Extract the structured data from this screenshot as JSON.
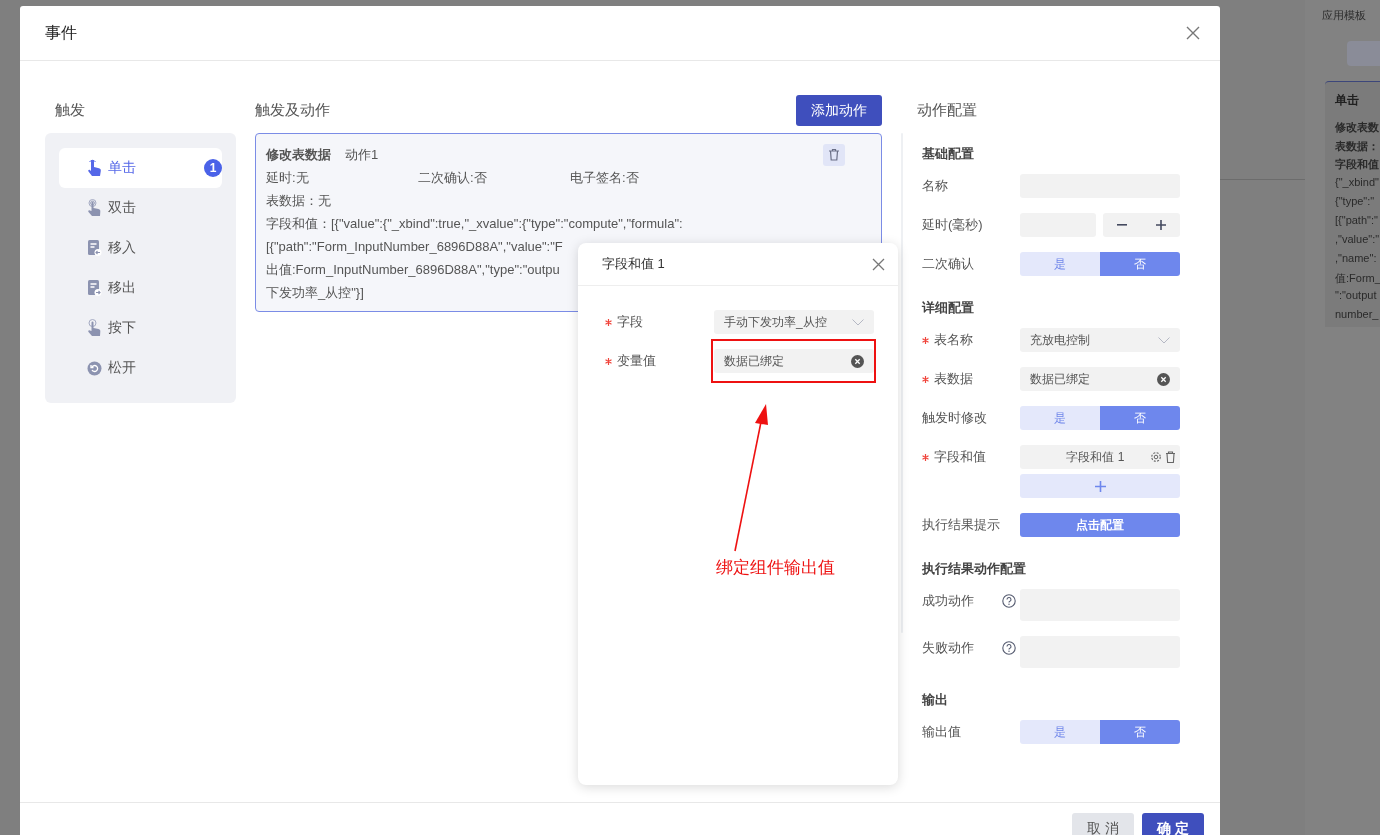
{
  "modal": {
    "title": "事件"
  },
  "trigger_panel": {
    "title": "触发",
    "items": [
      {
        "label": "单击",
        "kind": "tap",
        "selected": true,
        "badge": "1"
      },
      {
        "label": "双击",
        "kind": "double-tap",
        "selected": false
      },
      {
        "label": "移入",
        "kind": "enter",
        "selected": false
      },
      {
        "label": "移出",
        "kind": "leave",
        "selected": false
      },
      {
        "label": "按下",
        "kind": "press",
        "selected": false
      },
      {
        "label": "松开",
        "kind": "release",
        "selected": false
      }
    ]
  },
  "actions_panel": {
    "title": "触发及动作",
    "add_button": "添加动作",
    "actions": [
      {
        "name": "修改表数据",
        "label": "动作1",
        "selected": true,
        "details": [
          "延时:无",
          "二次确认:否",
          "电子签名:否"
        ],
        "table_data": "表数据：无",
        "field_lines": [
          "字段和值：[{\"value\":{\"_xbind\":true,\"_xvalue\":{\"type\":\"compute\",\"formula\":",
          "[{\"path\":\"Form_InputNumber_6896D88A\",\"value\":\"F",
          "出值:Form_InputNumber_6896D88A\",\"type\":\"outpu",
          "下发功率_从控\"}]"
        ]
      }
    ]
  },
  "config_panel": {
    "title": "动作配置",
    "rows": [
      {
        "kind": "section",
        "label": "基础配置"
      },
      {
        "kind": "input",
        "label": "名称",
        "required": false
      },
      {
        "kind": "stepper",
        "label": "延时(毫秒)",
        "required": false
      },
      {
        "kind": "toggle",
        "label": "二次确认",
        "required": false,
        "options": [
          {
            "label": "是",
            "selected": false
          },
          {
            "label": "否",
            "selected": true
          }
        ]
      },
      {
        "kind": "section",
        "label": "详细配置"
      },
      {
        "kind": "select",
        "label": "表名称",
        "required": true,
        "value": "充放电控制"
      },
      {
        "kind": "clearable",
        "label": "表数据",
        "required": true,
        "value": "数据已绑定"
      },
      {
        "kind": "toggle",
        "label": "触发时修改",
        "required": false,
        "options": [
          {
            "label": "是",
            "selected": false
          },
          {
            "label": "否",
            "selected": true
          }
        ]
      },
      {
        "kind": "list",
        "label": "字段和值",
        "required": true,
        "items": [
          "字段和值 1"
        ]
      },
      {
        "kind": "add"
      },
      {
        "kind": "button",
        "label": "执行结果提示",
        "required": false,
        "button": "点击配置"
      },
      {
        "kind": "section",
        "label": "执行结果动作配置"
      },
      {
        "kind": "textarea",
        "label": "成功动作",
        "required": false,
        "help": true
      },
      {
        "kind": "textarea",
        "label": "失败动作",
        "required": false,
        "help": true
      },
      {
        "kind": "section",
        "label": "输出"
      },
      {
        "kind": "toggle",
        "label": "输出值",
        "required": false,
        "options": [
          {
            "label": "是",
            "selected": false
          },
          {
            "label": "否",
            "selected": true
          }
        ]
      }
    ]
  },
  "field_dialog": {
    "title": "字段和值 1",
    "fields": [
      {
        "kind": "select",
        "label": "字段",
        "required": true,
        "value": "手动下发功率_从控",
        "highlighted": false
      },
      {
        "kind": "clearable",
        "label": "变量值",
        "required": true,
        "value": "数据已绑定",
        "highlighted": true
      }
    ]
  },
  "annotation": {
    "text": "绑定组件输出值"
  },
  "footer": {
    "buttons": [
      {
        "label": "取 消",
        "kind": "secondary"
      },
      {
        "label": "确 定",
        "kind": "primary"
      }
    ]
  },
  "background_page": {
    "tab": "应用模板",
    "card_title": "单击",
    "card_lines": [
      {
        "text": "修改表数",
        "bold": true
      },
      {
        "text": "表数据：",
        "bold": true
      },
      {
        "text": "字段和值",
        "bold": true
      },
      {
        "text": "{\"_xbind\"",
        "bold": false
      },
      {
        "text": "{\"type\":\"",
        "bold": false
      },
      {
        "text": "[{\"path\":\"",
        "bold": false
      },
      {
        "text": ",\"value\":\"",
        "bold": false
      },
      {
        "text": ",\"name\":",
        "bold": false
      },
      {
        "text": "值:Form_",
        "bold": false
      },
      {
        "text": "\":\"output",
        "bold": false
      },
      {
        "text": "number_",
        "bold": false
      }
    ]
  }
}
